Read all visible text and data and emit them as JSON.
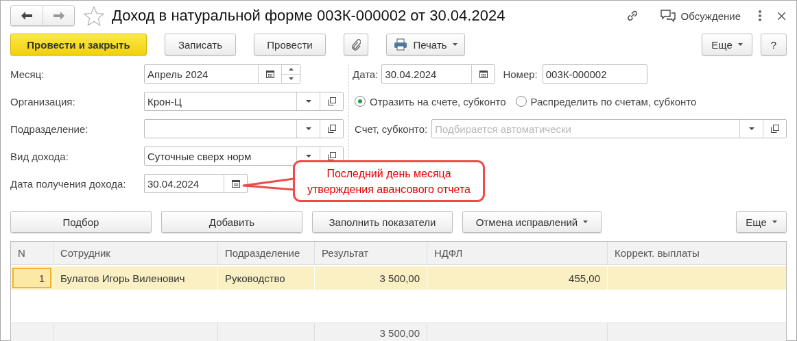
{
  "window": {
    "title": "Доход в натуральной форме 003К-000002 от 30.04.2024",
    "favorite": false,
    "discussion": "Обсуждение"
  },
  "toolbar": {
    "left": [
      {
        "label": "Провести и закрыть",
        "kind": "primary"
      },
      {
        "label": "Записать",
        "kind": "plain"
      },
      {
        "label": "Провести",
        "kind": "plain"
      },
      {
        "kind": "attach"
      },
      {
        "label": "Печать",
        "kind": "print"
      }
    ],
    "right": [
      {
        "label": "Еще",
        "kind": "menu"
      },
      {
        "label": "?",
        "kind": "plain"
      }
    ]
  },
  "fields": [
    {
      "label": "Месяц:",
      "value": "Апрель 2024",
      "kind": "period"
    },
    {
      "label": "Организация:",
      "value": "Крон-Ц",
      "kind": "ref"
    },
    {
      "label": "Подразделение:",
      "kind": "ref"
    },
    {
      "label": "Вид дохода:",
      "value": "Суточные сверх норм",
      "kind": "ref"
    },
    {
      "label": "Дата получения дохода:",
      "value": "30.04.2024",
      "kind": "date"
    }
  ],
  "date": {
    "label": "Дата:",
    "value": "30.04.2024"
  },
  "number": {
    "label": "Номер:",
    "value": "003К-000002"
  },
  "radios": [
    {
      "label": "Отразить на счете, субконто",
      "selected": true
    },
    {
      "label": "Распределить по счетам, субконто",
      "selected": false
    }
  ],
  "account": {
    "label": "Счет, субконто:",
    "placeholder": "Подбирается автоматически"
  },
  "callout": {
    "text": "Последний день месяца\nутверждения авансового отчета"
  },
  "table_toolbar": {
    "left": [
      {
        "label": "Подбор",
        "kind": "plain"
      },
      {
        "label": "Добавить",
        "kind": "plain"
      },
      {
        "label": "Заполнить показатели",
        "kind": "plain"
      },
      {
        "label": "Отмена исправлений",
        "kind": "menu"
      }
    ],
    "right": [
      {
        "label": "Еще",
        "kind": "menu"
      }
    ]
  },
  "table": {
    "columns": [
      "N",
      "Сотрудник",
      "Подразделение",
      "Результат",
      "НДФЛ",
      "Коррект. выплаты"
    ],
    "rows": [
      {
        "n": "1",
        "employee": "Булатов Игорь Виленович",
        "department": "Руководство",
        "result": "3 500,00",
        "ndfl": "455,00",
        "selected": true
      }
    ],
    "totals": {
      "result": "3 500,00"
    }
  }
}
